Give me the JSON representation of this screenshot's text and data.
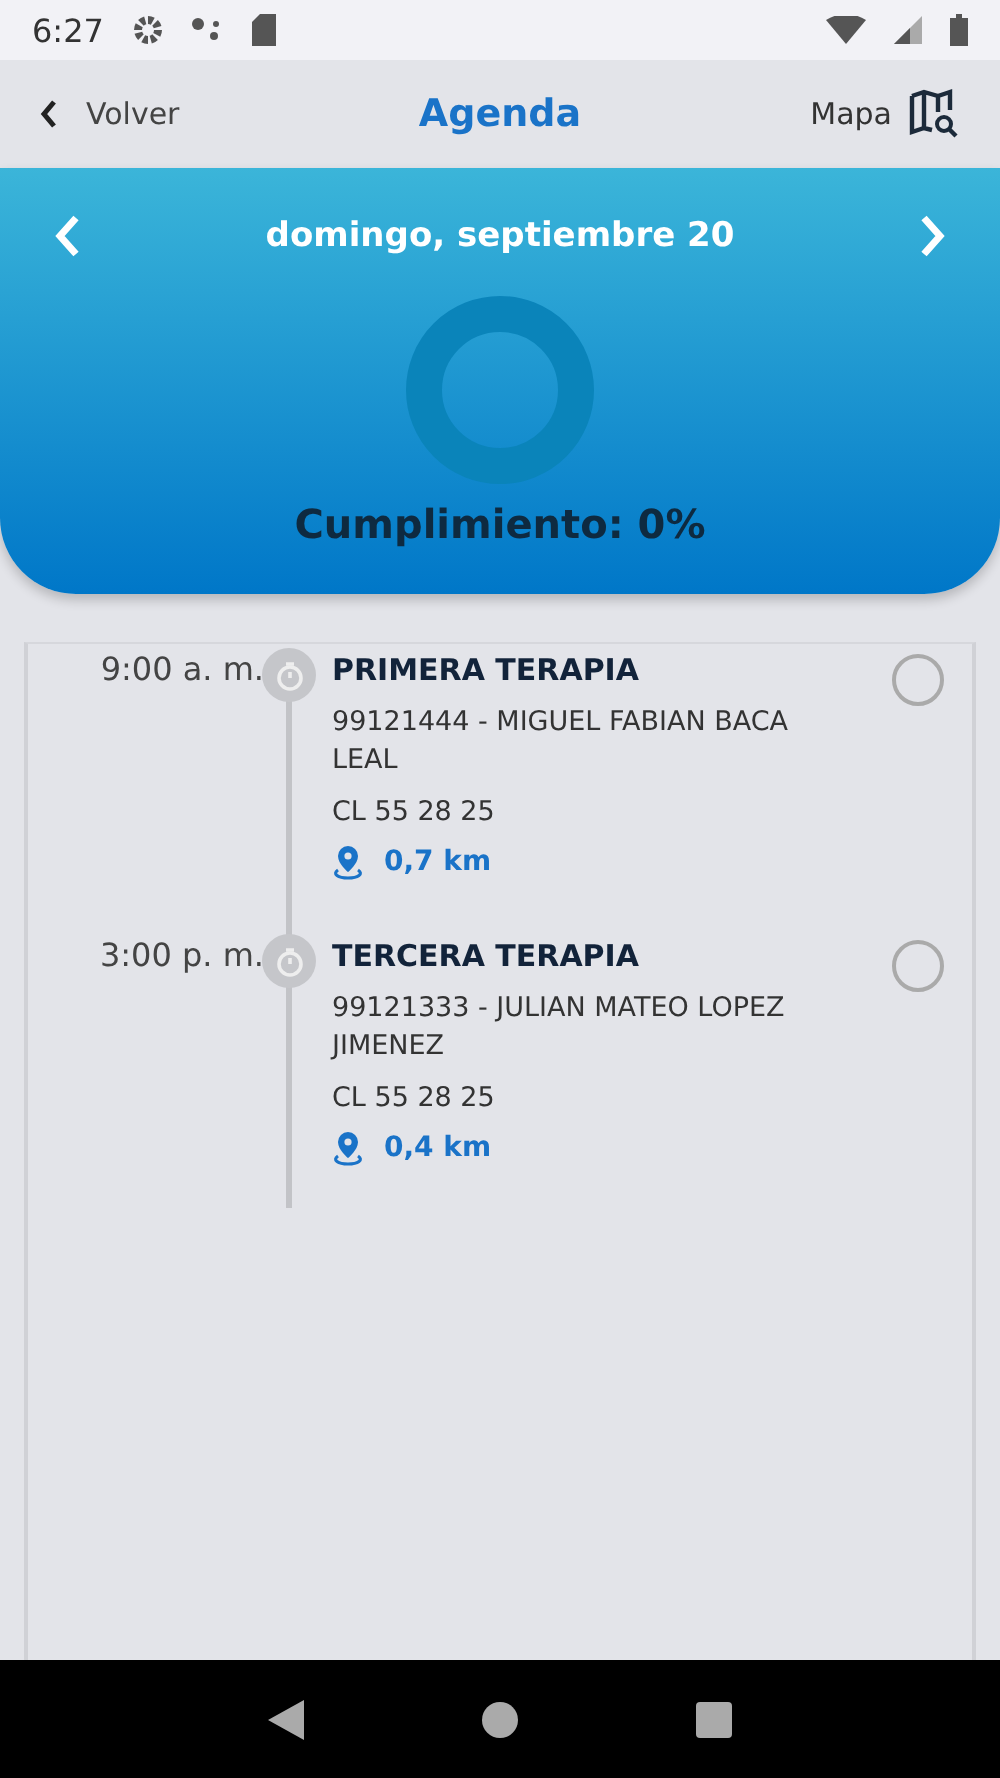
{
  "status_bar": {
    "time": "6:27"
  },
  "header": {
    "back": "Volver",
    "title": "Agenda",
    "map": "Mapa"
  },
  "day": {
    "date": "domingo, septiembre 20",
    "compliance": "Cumplimiento: 0%"
  },
  "appointments": [
    {
      "time": "9:00 a. m.",
      "title": "PRIMERA TERAPIA",
      "patient": "99121444 - MIGUEL FABIAN BACA LEAL",
      "address": "CL 55 28 25",
      "distance": "0,7 km",
      "checked": false
    },
    {
      "time": "3:00 p. m.",
      "title": "TERCERA TERAPIA",
      "patient": "99121333 - JULIAN MATEO LOPEZ JIMENEZ",
      "address": "CL 55 28 25",
      "distance": "0,4 km",
      "checked": false
    }
  ]
}
